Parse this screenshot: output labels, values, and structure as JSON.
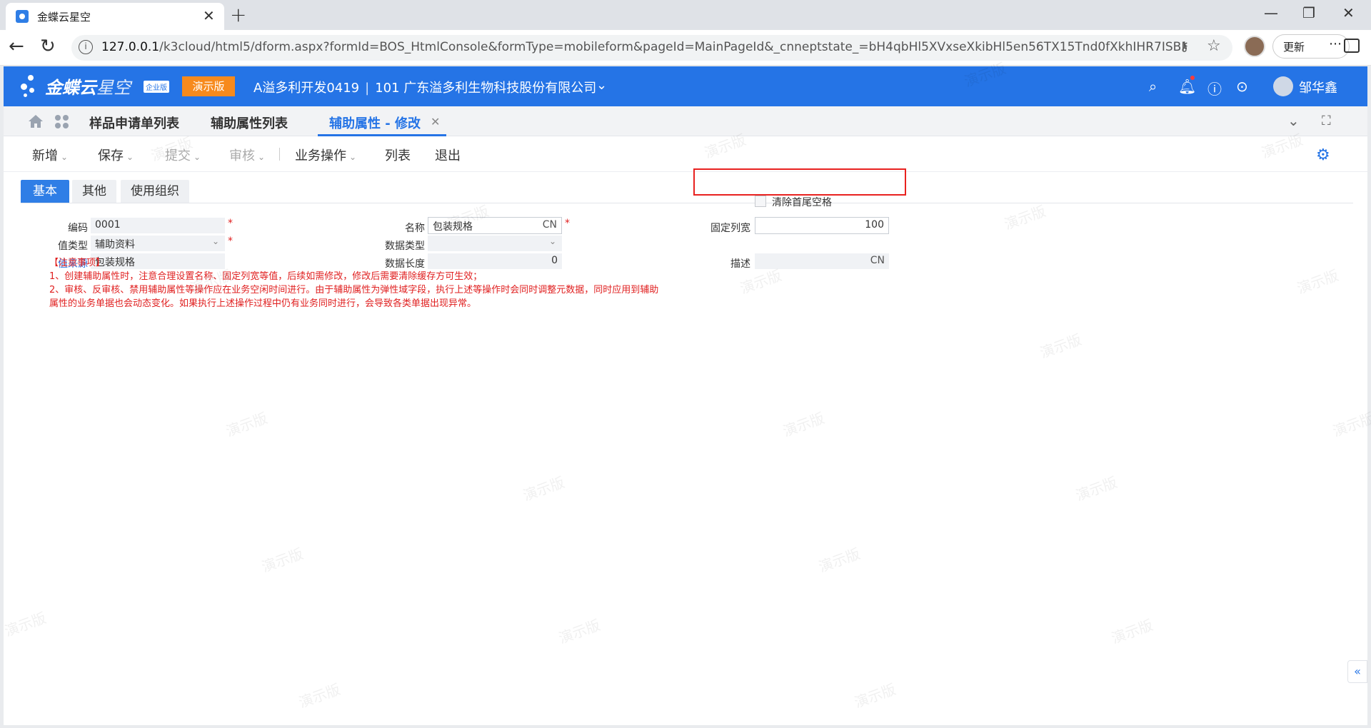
{
  "browser": {
    "tab_title": "金蝶云星空",
    "url_host": "127.0.0.1",
    "url_rest": "/k3cloud/html5/dform.aspx?formId=BOS_HtmlConsole&formType=mobileform&pageId=MainPageId&_cnneptstate_=bH4qbHl5XVxseXkibHl5en56TX15Tnd0fXkhIHR7ISBMdEp9TE50S...",
    "update_label": "更新"
  },
  "header": {
    "logo_main": "金蝶云",
    "logo_light": "星空",
    "logo_badge": "企业版",
    "demo_badge": "演示版",
    "account": "A溢多利开发0419",
    "org": "101 广东溢多利生物科技股份有限公司",
    "user_name": "邹华鑫"
  },
  "page_tabs": [
    {
      "label": "样品申请单列表"
    },
    {
      "label": "辅助属性列表"
    },
    {
      "label": "辅助属性 - 修改"
    }
  ],
  "toolbar": {
    "add": "新增",
    "save": "保存",
    "submit": "提交",
    "audit": "审核",
    "business": "业务操作",
    "list": "列表",
    "exit": "退出"
  },
  "form_tabs": [
    {
      "label": "基本"
    },
    {
      "label": "其他"
    },
    {
      "label": "使用组织"
    }
  ],
  "form": {
    "code_label": "编码",
    "code_value": "0001",
    "name_label": "名称",
    "name_value": "包装规格",
    "name_suffix": "CN",
    "fixed_width_label": "固定列宽",
    "fixed_width_value": "100",
    "value_type_label": "值类型",
    "value_type_value": "辅助资料",
    "data_type_label": "数据类型",
    "data_type_value": "",
    "trim_label": "清除首尾空格",
    "value_source_label": "值来源",
    "value_source_value": "包装规格",
    "data_length_label": "数据长度",
    "data_length_value": "0",
    "desc_label": "描述",
    "desc_suffix": "CN",
    "required_mark": "*"
  },
  "notes": {
    "title": "【注意事项】",
    "line1": "1、创建辅助属性时，注意合理设置名称、固定列宽等值，后续如需修改，修改后需要清除缓存方可生效；",
    "line2": "2、审核、反审核、禁用辅助属性等操作应在业务空闲时间进行。由于辅助属性为弹性域字段，执行上述等操作时会同时调整元数据，同时应用到辅助",
    "line3": "属性的业务单据也会动态变化。如果执行上述操作过程中仍有业务同时进行，会导致各类单据出现异常。"
  },
  "watermark_text": "演示版",
  "colors": {
    "brand_blue": "#2574e6",
    "demo_orange": "#f78a1d",
    "warning_red": "#e02020"
  }
}
